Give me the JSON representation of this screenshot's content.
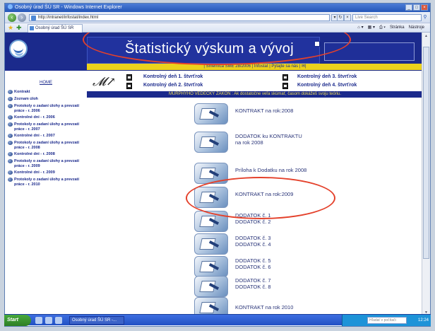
{
  "browser": {
    "title": "Osobný úrad ŠÚ SR - Windows Internet Explorer",
    "address": "http://intranet/infostat/index.html",
    "search_placeholder": "Live Search",
    "tab_label": "Osobný úrad ŠÚ SR",
    "commands": [
      "Stránka",
      "Nástroje"
    ]
  },
  "site": {
    "title": "Štatistický výskum a vývoj",
    "top_links": "| Smernica SME 28/2006 | Infostat | Pýtajte sa nás |",
    "murphy": "MURPHYHO VEDECKÝ ZÁKON : Ak dostatočne veľa skúmať, časom dokážeš svoju teóriu."
  },
  "control_links": [
    "Kontrolný deň 1. štvrťrok",
    "Kontrolný deň 3. štvrťrok",
    "Kontrolný deň 2. štvrťrok",
    "Kontrolný deň 4. štvrťrok"
  ],
  "sidebar": {
    "home": "HOME",
    "items": [
      "Kontrakt",
      "Zoznam úloh",
      "Protokoly o zadaní úlohy a prevzatí práce - r. 2006",
      "Kontrolné dni - r. 2006",
      "Protokoly o zadaní úlohy a prevzatí práce - r. 2007",
      "Kontrolné dni - r. 2007",
      "Protokoly o zadaní úlohy a prevzatí práce - r. 2008",
      "Kontrolné dni - r. 2008",
      "Protokoly o zadaní úlohy a prevzatí práce - r. 2009",
      "Kontrolné dni - r. 2009",
      "Protokoly o zadaní úlohy a prevzatí práce - r. 2010"
    ]
  },
  "documents": [
    "KONTRAKT na rok:2008",
    "DODATOK ku KONTRAKTU\nna rok 2008",
    "Príloha k Dodatku na rok 2008",
    "KONTRAKT na rok:2009",
    "DODATOK č. 1\nDODATOK č. 2",
    "DODATOK č. 3\nDODATOK č. 4",
    "DODATOK č. 5\nDODATOK č. 6",
    "DODATOK č. 7\nDODATOK č. 8",
    "KONTRAKT na rok 2010"
  ],
  "taskbar": {
    "start": "Start",
    "task": "Osobný úrad ŠÚ SR -...",
    "tray_search": "Hľadať v počítači",
    "clock": "12:24"
  },
  "colors": {
    "banner": "#1b2a8c",
    "accent_yellow": "#ecd21c",
    "highlight_red": "#e4412b"
  }
}
